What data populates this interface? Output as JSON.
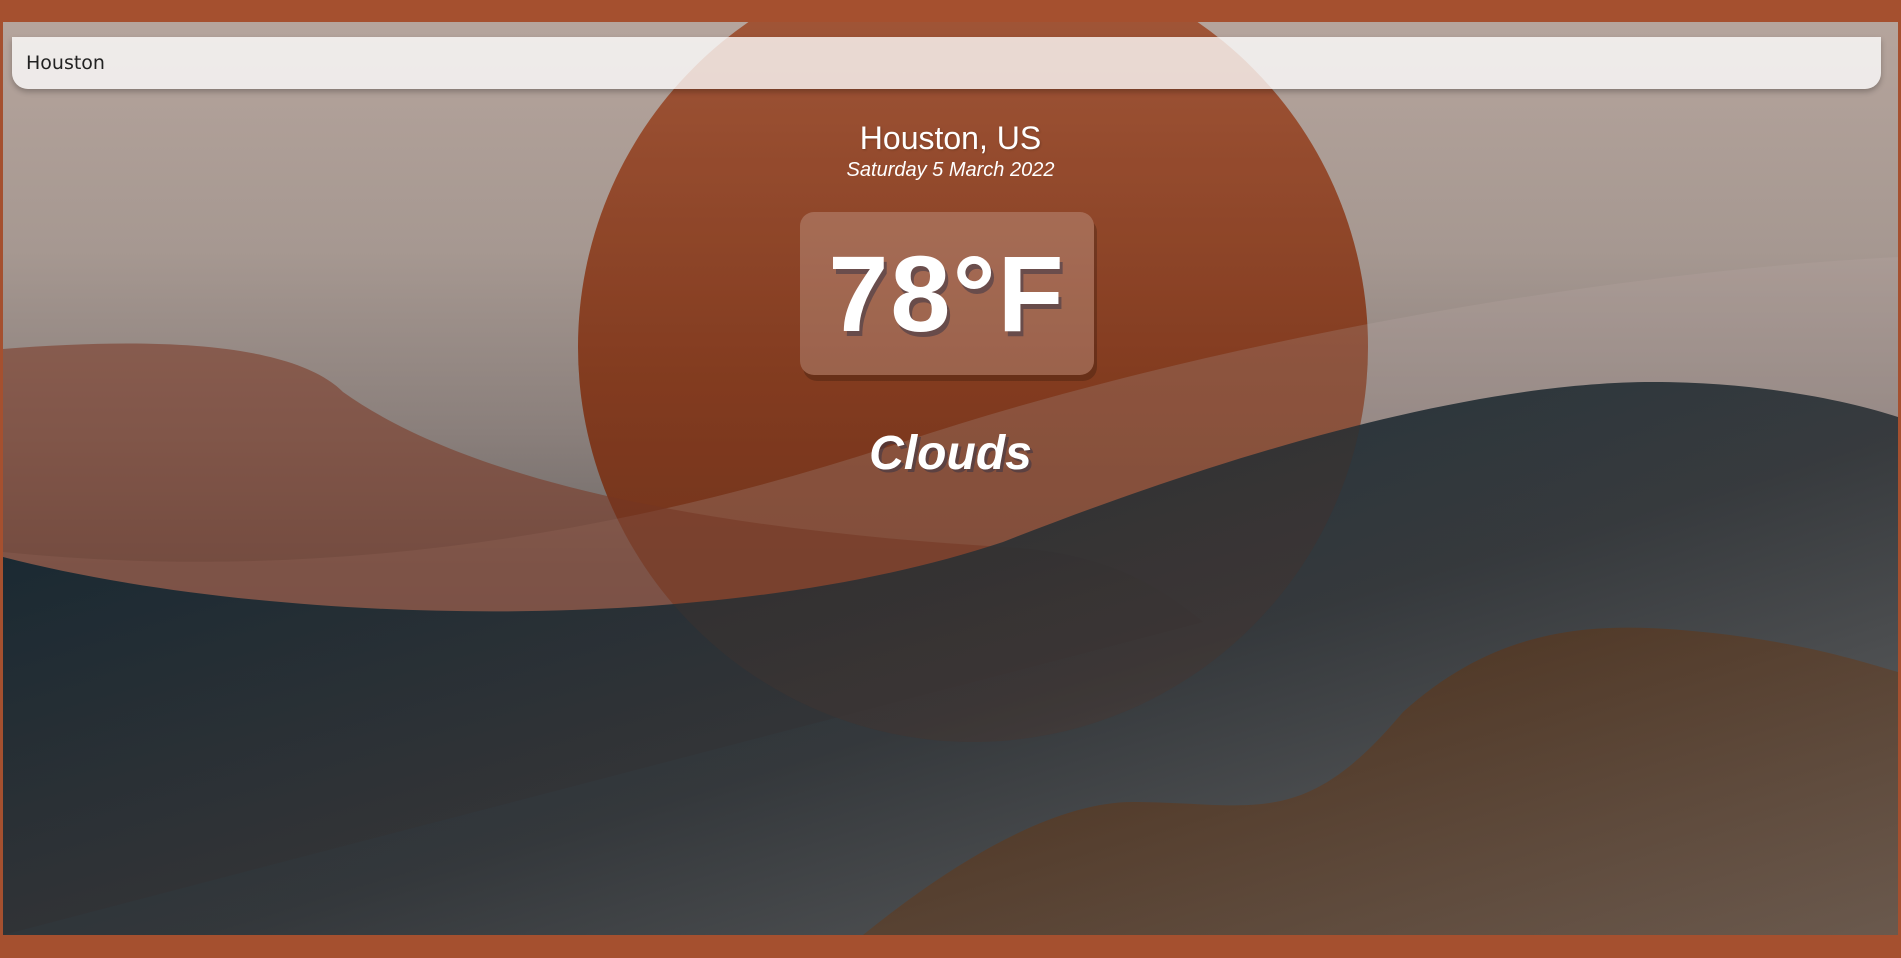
{
  "search": {
    "value": "Houston",
    "placeholder": ""
  },
  "weather": {
    "location": "Houston, US",
    "date": "Saturday 5 March 2022",
    "temperature": "78°F",
    "condition": "Clouds"
  },
  "colors": {
    "frame": "#a5502f",
    "sun": "#b55a36",
    "sky_top": "#b5a49c",
    "deep_blue": "#062230"
  }
}
